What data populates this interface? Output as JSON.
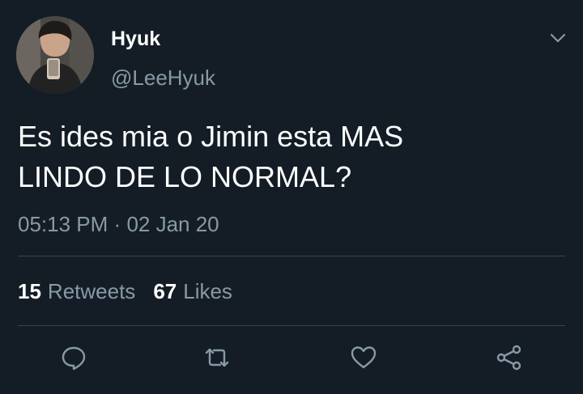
{
  "user": {
    "display_name": "Hyuk",
    "handle": "@LeeHyuk",
    "avatar": "profile-photo"
  },
  "tweet": {
    "text": "Es ides mia o Jimin esta MAS\nLINDO DE LO NORMAL?",
    "time": "05:13 PM",
    "separator": "·",
    "date": "02 Jan 20"
  },
  "stats": {
    "retweets_count": "15",
    "retweets_label": "Retweets",
    "likes_count": "67",
    "likes_label": "Likes"
  },
  "actions": {
    "reply_icon": "speech-bubble-icon",
    "retweet_icon": "retweet-arrows-icon",
    "like_icon": "heart-icon",
    "share_icon": "share-nodes-icon"
  },
  "colors": {
    "background": "#141d26",
    "primary_text": "#ffffff",
    "secondary_text": "#8899a6",
    "divider": "#38444d"
  }
}
